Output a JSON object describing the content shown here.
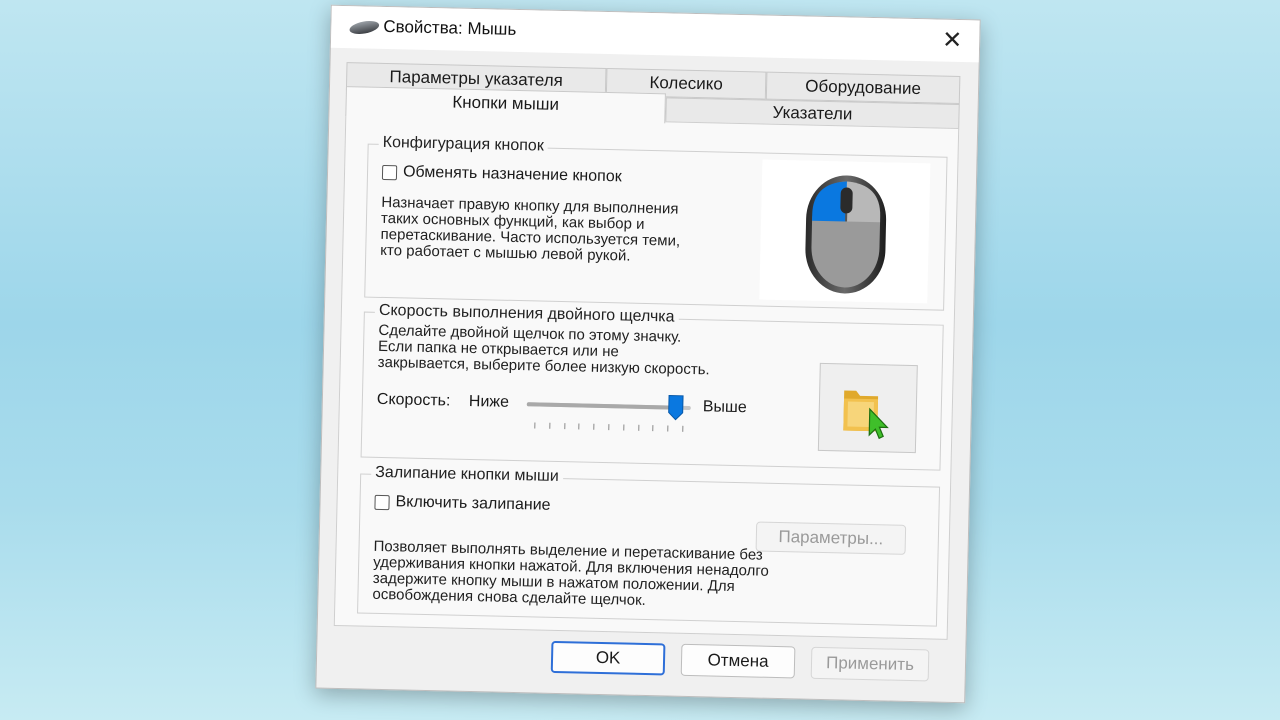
{
  "window": {
    "title": "Свойства: Мышь",
    "close_glyph": "✕"
  },
  "tabs": {
    "row_back": [
      {
        "label": "Параметры указателя"
      },
      {
        "label": "Колесико"
      },
      {
        "label": "Оборудование"
      }
    ],
    "row_front": [
      {
        "label": "Кнопки мыши",
        "active": true
      },
      {
        "label": "Указатели"
      }
    ]
  },
  "button_config": {
    "legend": "Конфигурация кнопок",
    "checkbox_label": "Обменять назначение кнопок",
    "checked": false,
    "description": [
      "Назначает правую кнопку для выполнения",
      "таких основных функций, как выбор и",
      "перетаскивание. Часто используется теми,",
      "кто работает с мышью левой рукой."
    ],
    "image_icon": "mouse-icon"
  },
  "double_click": {
    "legend": "Скорость выполнения двойного щелчка",
    "description": [
      "Сделайте двойной щелчок по этому значку.",
      "Если папка не открывается или не",
      "закрывается, выберите более низкую скорость."
    ],
    "speed_label": "Скорость:",
    "slow_label": "Ниже",
    "fast_label": "Выше",
    "slider_value": 0.95,
    "tick_count": 11,
    "test_icon": "folder-icon"
  },
  "click_lock": {
    "legend": "Залипание кнопки мыши",
    "checkbox_label": "Включить залипание",
    "checked": false,
    "settings_button": "Параметры...",
    "description": [
      "Позволяет выполнять выделение и перетаскивание без",
      "удерживания кнопки нажатой. Для включения ненадолго",
      "задержите кнопку мыши в нажатом положении. Для",
      "освобождения снова сделайте щелчок."
    ]
  },
  "footer": {
    "ok": "OK",
    "cancel": "Отмена",
    "apply": "Применить"
  },
  "colors": {
    "accent": "#0a78e0",
    "cursor_green": "#3fbf2a",
    "folder": "#f2c14e"
  }
}
